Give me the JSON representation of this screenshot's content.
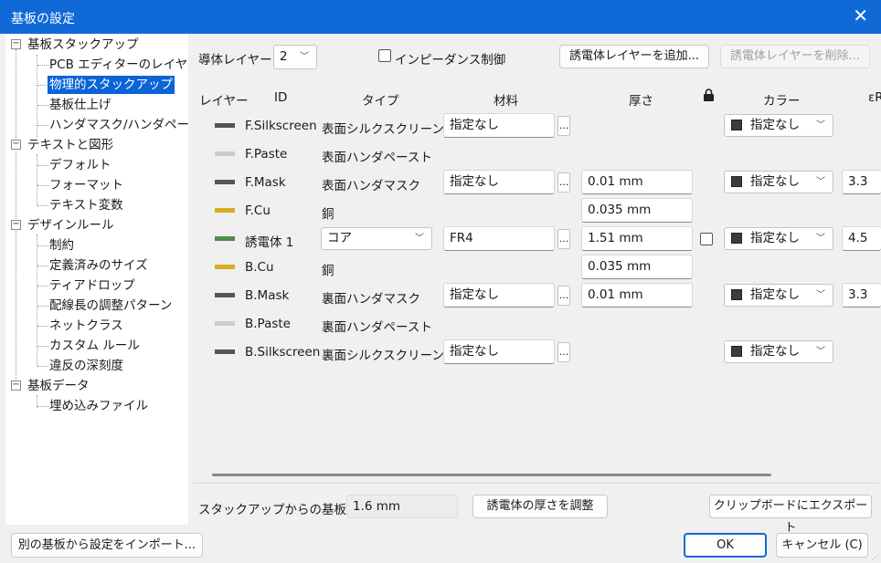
{
  "window": {
    "title": "基板の設定"
  },
  "tree": {
    "items": [
      {
        "label": "基板スタックアップ"
      },
      {
        "label": "PCB エディターのレイヤー"
      },
      {
        "label": "物理的スタックアップ"
      },
      {
        "label": "基板仕上げ"
      },
      {
        "label": "ハンダマスク/ハンダペースト"
      },
      {
        "label": "テキストと図形"
      },
      {
        "label": "デフォルト"
      },
      {
        "label": "フォーマット"
      },
      {
        "label": "テキスト変数"
      },
      {
        "label": "デザインルール"
      },
      {
        "label": "制約"
      },
      {
        "label": "定義済みのサイズ"
      },
      {
        "label": "ティアドロップ"
      },
      {
        "label": "配線長の調整パターン"
      },
      {
        "label": "ネットクラス"
      },
      {
        "label": "カスタム ルール"
      },
      {
        "label": "違反の深刻度"
      },
      {
        "label": "基板データ"
      },
      {
        "label": "埋め込みファイル"
      }
    ]
  },
  "toolbar": {
    "conductor_label": "導体レイヤー:",
    "conductor_value": "2",
    "impedance_label": "インピーダンス制御",
    "add_dielectric": "誘電体レイヤーを追加...",
    "remove_dielectric": "誘電体レイヤーを削除..."
  },
  "columns": {
    "layer": "レイヤー",
    "id": "ID",
    "type": "タイプ",
    "material": "材料",
    "thickness": "厚さ",
    "color": "カラー",
    "er": "εR"
  },
  "rows": [
    {
      "swatch": "#555555",
      "id": "F.Silkscreen",
      "type": "表面シルクスクリーン",
      "material": "指定なし",
      "thickness": "",
      "color": "指定なし",
      "er": ""
    },
    {
      "swatch": "#cccccc",
      "id": "F.Paste",
      "type": "表面ハンダペースト",
      "material": "",
      "thickness": "",
      "color": "",
      "er": ""
    },
    {
      "swatch": "#555555",
      "id": "F.Mask",
      "type": "表面ハンダマスク",
      "material": "指定なし",
      "thickness": "0.01 mm",
      "color": "指定なし",
      "er": "3.3"
    },
    {
      "swatch": "#d9ac24",
      "id": "F.Cu",
      "type": "銅",
      "material": "",
      "thickness": "0.035 mm",
      "color": "",
      "er": ""
    },
    {
      "swatch": "#4f8a4c",
      "id": "誘電体 1",
      "type": "コア",
      "material": "FR4",
      "thickness": "1.51 mm",
      "color": "指定なし",
      "er": "4.5"
    },
    {
      "swatch": "#d9ac24",
      "id": "B.Cu",
      "type": "銅",
      "material": "",
      "thickness": "0.035 mm",
      "color": "",
      "er": ""
    },
    {
      "swatch": "#555555",
      "id": "B.Mask",
      "type": "裏面ハンダマスク",
      "material": "指定なし",
      "thickness": "0.01 mm",
      "color": "指定なし",
      "er": "3.3"
    },
    {
      "swatch": "#cccccc",
      "id": "B.Paste",
      "type": "裏面ハンダペースト",
      "material": "",
      "thickness": "",
      "color": "",
      "er": ""
    },
    {
      "swatch": "#555555",
      "id": "B.Silkscreen",
      "type": "裏面シルクスクリーン",
      "material": "指定なし",
      "thickness": "",
      "color": "指定なし",
      "er": ""
    }
  ],
  "ellipsis": "...",
  "footer": {
    "thickness_label": "スタックアップからの基板厚:",
    "thickness_value": "1.6 mm",
    "adjust_button": "誘電体の厚さを調整",
    "export_button": "クリップボードにエクスポート"
  },
  "dialog": {
    "import_button": "別の基板から設定をインポート...",
    "ok_button": "OK",
    "cancel_button": "キャンセル (C)"
  },
  "icons": {
    "close": "close-icon",
    "lock": "lock-icon",
    "expand": "tree-collapse-icon"
  }
}
